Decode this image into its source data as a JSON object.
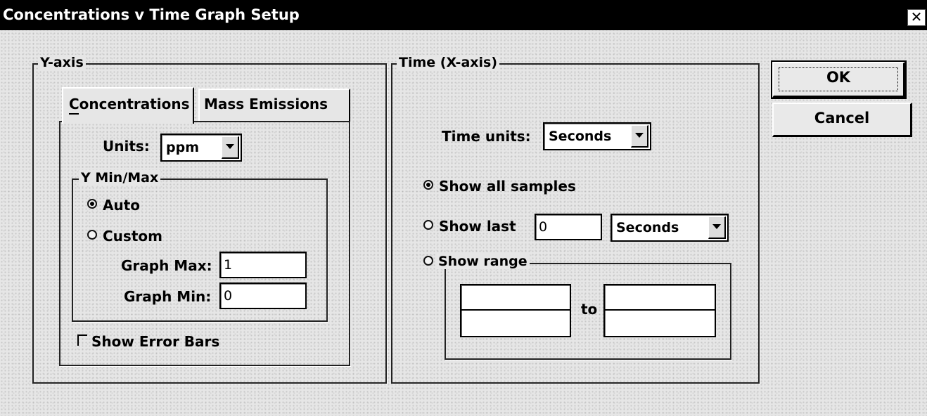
{
  "window": {
    "title": "Concentrations v Time Graph Setup",
    "close_glyph": "✕"
  },
  "y_axis": {
    "group_label": "Y-axis",
    "tabs": [
      {
        "label": "Concentrations",
        "selected": true
      },
      {
        "label": "Mass Emissions",
        "selected": false
      }
    ],
    "units_label": "Units:",
    "units_value": "ppm",
    "minmax": {
      "group_label": "Y Min/Max",
      "auto_label": "Auto",
      "auto_selected": true,
      "custom_label": "Custom",
      "custom_selected": false,
      "graph_max_label": "Graph Max:",
      "graph_max_value": "1",
      "graph_min_label": "Graph Min:",
      "graph_min_value": "0"
    },
    "show_error_bars_label": "Show Error Bars",
    "show_error_bars_checked": false
  },
  "time_axis": {
    "group_label": "Time (X-axis)",
    "time_units_label": "Time units:",
    "time_units_value": "Seconds",
    "show_all_label": "Show all samples",
    "show_all_selected": true,
    "show_last_label": "Show last",
    "show_last_selected": false,
    "show_last_value": "0",
    "show_last_units": "Seconds",
    "show_range_label": "Show range",
    "show_range_selected": false,
    "range_to_label": "to"
  },
  "buttons": {
    "ok_label": "OK",
    "cancel_label": "Cancel"
  }
}
